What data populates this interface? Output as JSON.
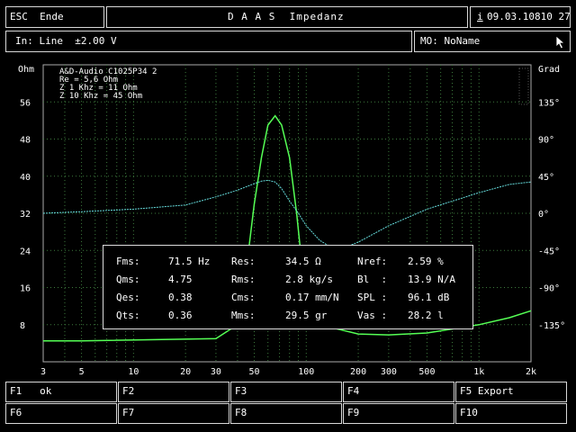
{
  "header": {
    "esc_label": "ESC  Ende",
    "title": "D A A S  Impedanz",
    "info_icon": "i",
    "datetime": "09.03.10810 27"
  },
  "status": {
    "input": "In: Line  ±2.00 V",
    "mo": "MO: NoName"
  },
  "chart_data": {
    "type": "line",
    "left_axis_label": "Ohm",
    "right_axis_label": "Grad",
    "legend_lines": [
      "A&D-Audio C1025P34    2",
      "Re = 5,6 Ohm",
      "Z 1 Khz = 11 Ohm",
      "Z 10 Khz = 45 Ohm"
    ],
    "y_ticks_left": [
      "56",
      "48",
      "40",
      "32",
      "24",
      "16",
      "8"
    ],
    "y_ticks_right": [
      "135°",
      "90°",
      "45°",
      "0°",
      "-45°",
      "-90°",
      "-135°"
    ],
    "x_ticks": [
      "3",
      "5",
      "10",
      "20",
      "30",
      "50",
      "100",
      "200",
      "300",
      "500",
      "1k",
      "2k"
    ],
    "x_scale": "log",
    "xlim": [
      3,
      2000
    ],
    "ylim_ohm": [
      0,
      64
    ],
    "ylim_deg": [
      -180,
      180
    ],
    "grid": true,
    "series": [
      {
        "color": "#55ff55",
        "values": [
          [
            3,
            4.5
          ],
          [
            5,
            4.5
          ],
          [
            30,
            5
          ],
          [
            40,
            8
          ],
          [
            45,
            20
          ],
          [
            50,
            34
          ],
          [
            55,
            44
          ],
          [
            60,
            51
          ],
          [
            66,
            53
          ],
          [
            72,
            51
          ],
          [
            80,
            44
          ],
          [
            88,
            32
          ],
          [
            95,
            20
          ],
          [
            100,
            12
          ],
          [
            120,
            8
          ],
          [
            200,
            6
          ],
          [
            300,
            5.8
          ],
          [
            500,
            6.2
          ],
          [
            1000,
            8
          ],
          [
            1500,
            9.5
          ],
          [
            2000,
            11
          ]
        ]
      },
      {
        "color": "#66dddd",
        "values": [
          [
            3,
            0
          ],
          [
            5,
            2
          ],
          [
            10,
            5
          ],
          [
            20,
            10
          ],
          [
            30,
            20
          ],
          [
            40,
            28
          ],
          [
            50,
            36
          ],
          [
            55,
            39
          ],
          [
            60,
            40
          ],
          [
            66,
            38
          ],
          [
            72,
            30
          ],
          [
            80,
            15
          ],
          [
            90,
            0
          ],
          [
            100,
            -15
          ],
          [
            120,
            -33
          ],
          [
            150,
            -45
          ],
          [
            200,
            -35
          ],
          [
            300,
            -15
          ],
          [
            500,
            5
          ],
          [
            1000,
            25
          ],
          [
            1500,
            35
          ],
          [
            2000,
            38
          ]
        ]
      }
    ]
  },
  "params": [
    [
      {
        "label": "Fms:",
        "value": "71.5 Hz"
      },
      {
        "label": "Res:",
        "value": "34.5 Ω"
      },
      {
        "label": "Nref:",
        "value": "2.59 %"
      }
    ],
    [
      {
        "label": "Qms:",
        "value": "4.75"
      },
      {
        "label": "Rms:",
        "value": "2.8 kg/s"
      },
      {
        "label": "Bl  :",
        "value": "13.9 N/A"
      }
    ],
    [
      {
        "label": "Qes:",
        "value": "0.38"
      },
      {
        "label": "Cms:",
        "value": "0.17 mm/N"
      },
      {
        "label": "SPL :",
        "value": "96.1 dB"
      }
    ],
    [
      {
        "label": "Qts:",
        "value": "0.36"
      },
      {
        "label": "Mms:",
        "value": "29.5 gr"
      },
      {
        "label": "Vas :",
        "value": "28.2 l"
      }
    ]
  ],
  "fkeys": [
    "F1   ok",
    "F2",
    "F3",
    "F4",
    "F5 Export",
    "F6",
    "F7",
    "F8",
    "F9",
    "F10"
  ]
}
